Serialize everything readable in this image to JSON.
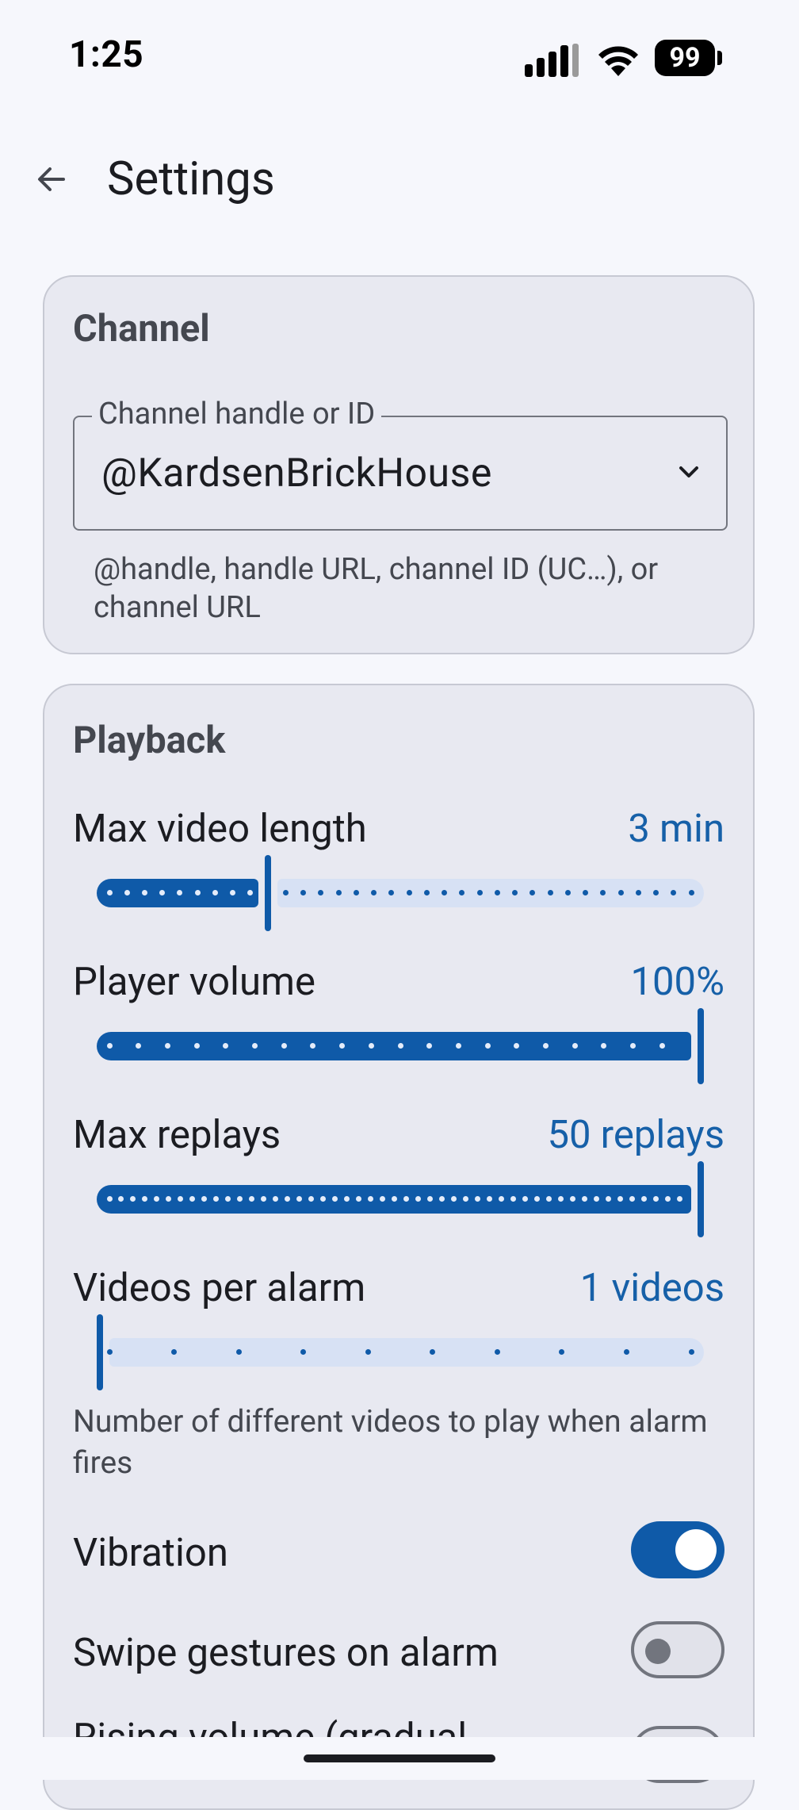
{
  "status_bar": {
    "time": "1:25",
    "battery": "99"
  },
  "app_bar": {
    "title": "Settings"
  },
  "channel": {
    "section_title": "Channel",
    "field_label": "Channel handle or ID",
    "field_value": "@KardsenBrickHouse",
    "helper_text": "@handle, handle URL, channel ID (UC…), or channel URL"
  },
  "playback": {
    "section_title": "Playback",
    "max_video_length": {
      "label": "Max video length",
      "value": "3 min",
      "level": 0.28
    },
    "player_volume": {
      "label": "Player volume",
      "value": "100%",
      "level": 1.0
    },
    "max_replays": {
      "label": "Max replays",
      "value": "50 replays",
      "level": 1.0
    },
    "videos_per_alarm": {
      "label": "Videos per alarm",
      "value": "1 videos",
      "level": 0.0,
      "description": "Number of different videos to play when alarm fires"
    },
    "vibration": {
      "label": "Vibration",
      "on": true
    },
    "swipe_gestures": {
      "label": "Swipe gestures on alarm",
      "on": false
    },
    "rising_volume": {
      "label": "Rising volume (gradual"
    }
  },
  "colors": {
    "accent": "#0f5aa8",
    "value_text": "#1660a8",
    "card": "#e8e9f1",
    "background": "#f6f7fc"
  }
}
